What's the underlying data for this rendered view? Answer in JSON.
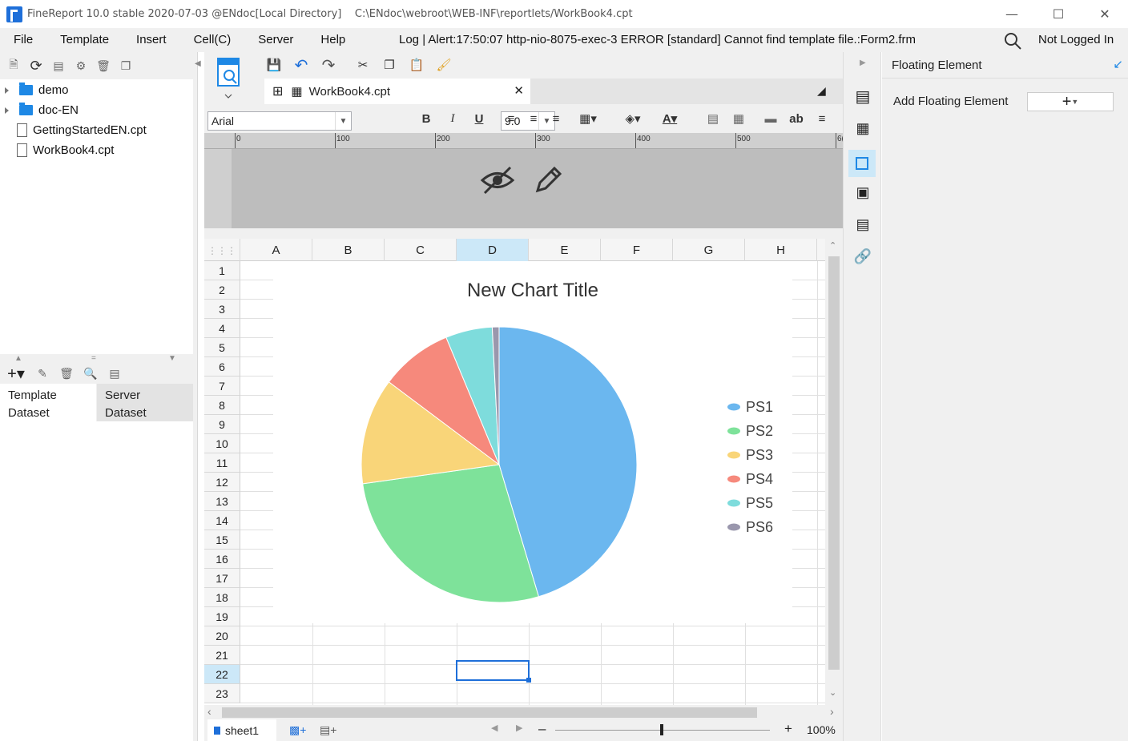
{
  "window": {
    "title": "FineReport 10.0 stable 2020-07-03 @ENdoc[Local Directory]    C:\\ENdoc\\webroot\\WEB-INF\\reportlets/WorkBook4.cpt",
    "controls": [
      "minimize",
      "maximize",
      "close"
    ]
  },
  "menu": {
    "items": [
      "File",
      "Template",
      "Insert",
      "Cell(C)",
      "Server",
      "Help"
    ],
    "log": "Log | Alert:17:50:07 http-nio-8075-exec-3 ERROR [standard] Cannot find template file.:Form2.frm",
    "login_status": "Not Logged In"
  },
  "tree": {
    "items": [
      {
        "label": "demo",
        "type": "folder"
      },
      {
        "label": "doc-EN",
        "type": "folder"
      },
      {
        "label": "GettingStartedEN.cpt",
        "type": "file"
      },
      {
        "label": "WorkBook4.cpt",
        "type": "file"
      }
    ]
  },
  "dataset": {
    "tab_template": "Template\nDataset",
    "tab_server": "Server\nDataset",
    "tab_template_1": "Template",
    "tab_template_2": "Dataset",
    "tab_server_1": "Server",
    "tab_server_2": "Dataset"
  },
  "editor": {
    "tab_label": "WorkBook4.cpt",
    "font_name": "Arial",
    "font_size": "9.0",
    "ruler_ticks": [
      "0",
      "100",
      "200",
      "300",
      "400",
      "500",
      "6("
    ],
    "columns": [
      "A",
      "B",
      "C",
      "D",
      "E",
      "F",
      "G",
      "H"
    ],
    "rows": [
      "1",
      "2",
      "3",
      "4",
      "5",
      "6",
      "7",
      "8",
      "9",
      "10",
      "11",
      "12",
      "13",
      "14",
      "15",
      "16",
      "17",
      "18",
      "19",
      "20",
      "21",
      "22",
      "23"
    ],
    "selected_column": "D",
    "selected_row": "22",
    "sheet_tab": "sheet1",
    "zoom": "100%"
  },
  "chart_data": {
    "type": "pie",
    "title": "New Chart Title",
    "categories": [
      "PS1",
      "PS2",
      "PS3",
      "PS4",
      "PS5",
      "PS6"
    ],
    "values": [
      45.5,
      27.5,
      12.5,
      8.5,
      5.5,
      0.8
    ],
    "colors": [
      "#6bb7ef",
      "#7ee29a",
      "#f9d579",
      "#f6897c",
      "#7edcdc",
      "#9a97ad"
    ],
    "legend_position": "right"
  },
  "right_panel": {
    "title": "Floating Element",
    "add_label": "Add Floating Element",
    "add_button": "+"
  },
  "colors": {
    "accent": "#1e88e5",
    "selection": "#1e6fd9",
    "header_highlight": "#cce8f8"
  }
}
